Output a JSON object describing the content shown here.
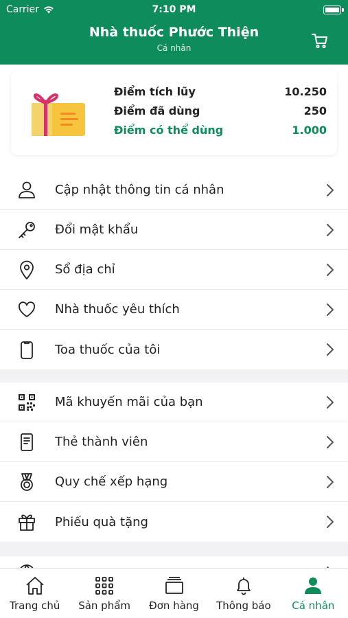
{
  "status_bar": {
    "carrier": "Carrier",
    "time": "7:10 PM"
  },
  "header": {
    "title": "Nhà thuốc Phước Thiện",
    "subtitle": "Cá nhân"
  },
  "points": {
    "accumulated_label": "Điểm tích lũy",
    "accumulated_value": "10.250",
    "used_label": "Điểm đã dùng",
    "used_value": "250",
    "available_label": "Điểm có thể dùng",
    "available_value": "1.000"
  },
  "menu_group_1": [
    {
      "label": "Cập nhật thông tin cá nhân",
      "icon": "user-icon"
    },
    {
      "label": "Đổi mật khẩu",
      "icon": "key-icon"
    },
    {
      "label": "Sổ địa chỉ",
      "icon": "location-pin-icon"
    },
    {
      "label": "Nhà thuốc yêu thích",
      "icon": "heart-icon"
    },
    {
      "label": "Toa thuốc của tôi",
      "icon": "clipboard-icon"
    }
  ],
  "menu_group_2": [
    {
      "label": "Mã khuyến mãi của bạn",
      "icon": "qr-code-icon"
    },
    {
      "label": "Thẻ thành viên",
      "icon": "member-card-icon"
    },
    {
      "label": "Quy chế xếp hạng",
      "icon": "medal-icon"
    },
    {
      "label": "Phiếu quà tặng",
      "icon": "gift-icon"
    }
  ],
  "tabs": [
    {
      "label": "Trang chủ",
      "icon": "home-icon"
    },
    {
      "label": "Sản phẩm",
      "icon": "grid-icon"
    },
    {
      "label": "Đơn hàng",
      "icon": "orders-icon"
    },
    {
      "label": "Thông báo",
      "icon": "bell-icon"
    },
    {
      "label": "Cá nhân",
      "icon": "profile-icon",
      "active": true
    }
  ],
  "colors": {
    "brand": "#0e8c5c",
    "gift_box": "#f7c43e",
    "ribbon": "#d6336c"
  }
}
